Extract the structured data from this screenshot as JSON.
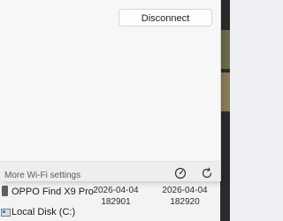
{
  "flyout": {
    "disconnect_label": "Disconnect",
    "more_settings_label": "More Wi-Fi settings",
    "icons": [
      "speedometer-icon",
      "refresh-icon"
    ]
  },
  "explorer": {
    "items": [
      {
        "label": "OPPO Find X9 Pro",
        "icon": "phone-device-icon",
        "col1": [
          "2026-04-04",
          "182901"
        ],
        "col2": [
          "2026-04-04",
          "182920"
        ]
      },
      {
        "label": "Local Disk (C:)",
        "icon": "local-disk-icon"
      }
    ]
  }
}
